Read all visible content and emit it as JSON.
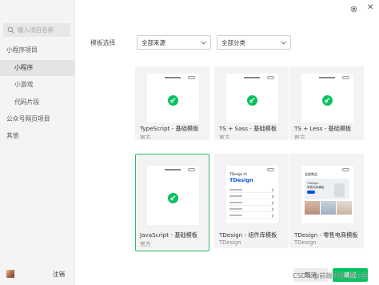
{
  "sidebar": {
    "search_placeholder": "输入项目名称",
    "items": [
      {
        "label": "小程序项目"
      },
      {
        "label": "小程序"
      },
      {
        "label": "小游戏"
      },
      {
        "label": "代码片段"
      },
      {
        "label": "公众号网页项目"
      },
      {
        "label": "其他"
      }
    ],
    "logout_label": "注销"
  },
  "header": {
    "settings_icon": "gear-icon",
    "close_icon": "close-icon"
  },
  "filters": {
    "label": "模板选择",
    "source": {
      "value": "全部来源"
    },
    "category": {
      "value": "全部分类"
    }
  },
  "templates": [
    {
      "name": "TypeScript - 基础模板",
      "author": "官方",
      "preview": "miniprogram-logo",
      "selected": false
    },
    {
      "name": "TS + Sass - 基础模板",
      "author": "官方",
      "preview": "miniprogram-logo",
      "selected": false
    },
    {
      "name": "TS + Less - 基础模板",
      "author": "官方",
      "preview": "miniprogram-logo",
      "selected": false
    },
    {
      "name": "JavaScript - 基础模板",
      "author": "官方",
      "preview": "miniprogram-logo",
      "selected": true
    },
    {
      "name": "TDesign - 组件库模板",
      "author": "TDesign",
      "preview": "tdesign-components",
      "selected": false
    },
    {
      "name": "TDesign - 零售电商模板",
      "author": "TDesign",
      "preview": "tdesign-retail",
      "selected": false
    }
  ],
  "tdesign_preview": {
    "head": "TDesign UI",
    "logo": "TDesign"
  },
  "retail_preview": {
    "head": "全部商品",
    "line1": "TDesign",
    "line2": "零售电商模板"
  },
  "footer": {
    "cancel_label": "取消",
    "confirm_label": "确定",
    "watermark": "CSDN @前端开发_穆小白"
  },
  "colors": {
    "accent": "#07c160",
    "selected_border": "#2fb965",
    "tdesign_blue": "#0052d9"
  }
}
